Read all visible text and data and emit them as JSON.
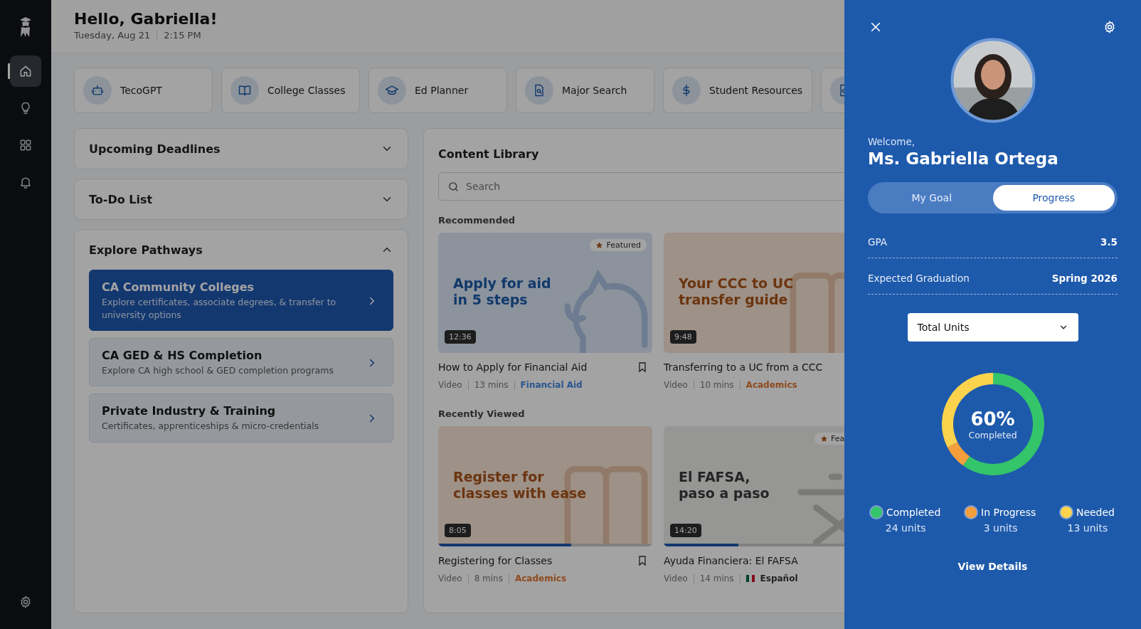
{
  "sidebar": {
    "items": [
      {
        "selected": true
      },
      {
        "selected": false
      },
      {
        "selected": false
      },
      {
        "selected": false
      }
    ]
  },
  "header": {
    "greeting": "Hello, Gabriella!",
    "date": "Tuesday, Aug 21",
    "time": "2:15 PM"
  },
  "shortcuts": [
    {
      "label": "TecoGPT"
    },
    {
      "label": "College Classes"
    },
    {
      "label": "Ed Planner"
    },
    {
      "label": "Major Search"
    },
    {
      "label": "Student Resources"
    },
    {
      "kind": "partial"
    }
  ],
  "panels": [
    {
      "title": "Upcoming Deadlines",
      "expanded": false
    },
    {
      "title": "To-Do List",
      "expanded": false
    },
    {
      "title": "Explore Pathways",
      "expanded": true,
      "items": [
        {
          "title": "CA Community Colleges",
          "description": "Explore certificates, associate degrees, & transfer to university options",
          "selected": true
        },
        {
          "title": "CA GED & HS Completion",
          "description": "Explore CA high school & GED completion programs",
          "selected": false
        },
        {
          "title": "Private Industry & Training",
          "description": "Certificates, apprenticeships & micro-credentials",
          "selected": false
        }
      ]
    }
  ],
  "content_library": {
    "title": "Content Library",
    "search": {
      "placeholder": "Search"
    },
    "sections": [
      {
        "heading": "Recommended",
        "cards": [
          {
            "headline": [
              "Apply for aid",
              "in 5 steps"
            ],
            "featured": "Featured",
            "duration": "12:36",
            "title": "How to Apply for Financial Aid",
            "bookmark": true,
            "type": "Video",
            "length": "13 mins",
            "tag": "Financial Aid",
            "color": "#28568f"
          },
          {
            "headline": [
              "Your CCC to UC",
              "transfer guide"
            ],
            "duration": "9:48",
            "title": "Transferring to a UC from a CCC",
            "bookmark": false,
            "type": "Video",
            "length": "10 mins",
            "tag": "Academics",
            "color": "#8f4a1c"
          }
        ]
      },
      {
        "heading": "Recently Viewed",
        "cards": [
          {
            "headline": [
              "Register for",
              "classes with ease"
            ],
            "duration": "8:05",
            "level": 0.62,
            "title": "Registering for Classes",
            "bookmark": true,
            "type": "Video",
            "length": "8 mins",
            "tag": "Academics",
            "color": "#8f4a1c"
          },
          {
            "headline": [
              "El FAFSA,",
              "paso a paso"
            ],
            "featured": "Fea",
            "duration": "14:20",
            "level": 0.35,
            "title": "Ayuda Financiera: El FAFSA",
            "bookmark": false,
            "type": "Video",
            "length": "14 mins",
            "tag": "Español",
            "tag_flag": true,
            "color": "#222222"
          }
        ]
      }
    ]
  },
  "drawer": {
    "welcome": "Welcome,",
    "name": "Ms. Gabriella Ortega",
    "tabs": [
      {
        "label": "My Goal",
        "selected": false
      },
      {
        "label": "Progress",
        "selected": true
      }
    ],
    "stats": [
      {
        "label": "GPA",
        "value": "3.5"
      },
      {
        "label": "Expected Graduation",
        "value": "Spring 2026"
      }
    ],
    "dropdown": {
      "value": "Total Units"
    },
    "center_value": "60%",
    "center_label": "Completed",
    "chart_data": {
      "type": "donut",
      "categories": [
        "Completed",
        "In Progress",
        "Needed"
      ],
      "values": [
        60,
        7.5,
        32.5
      ]
    },
    "legend": [
      {
        "units": "24 units",
        "color": "#34c46a"
      },
      {
        "units": "3 units",
        "color": "#f59e3c"
      },
      {
        "units": "13 units",
        "color": "#fcd34d"
      }
    ],
    "link": "View Details"
  }
}
